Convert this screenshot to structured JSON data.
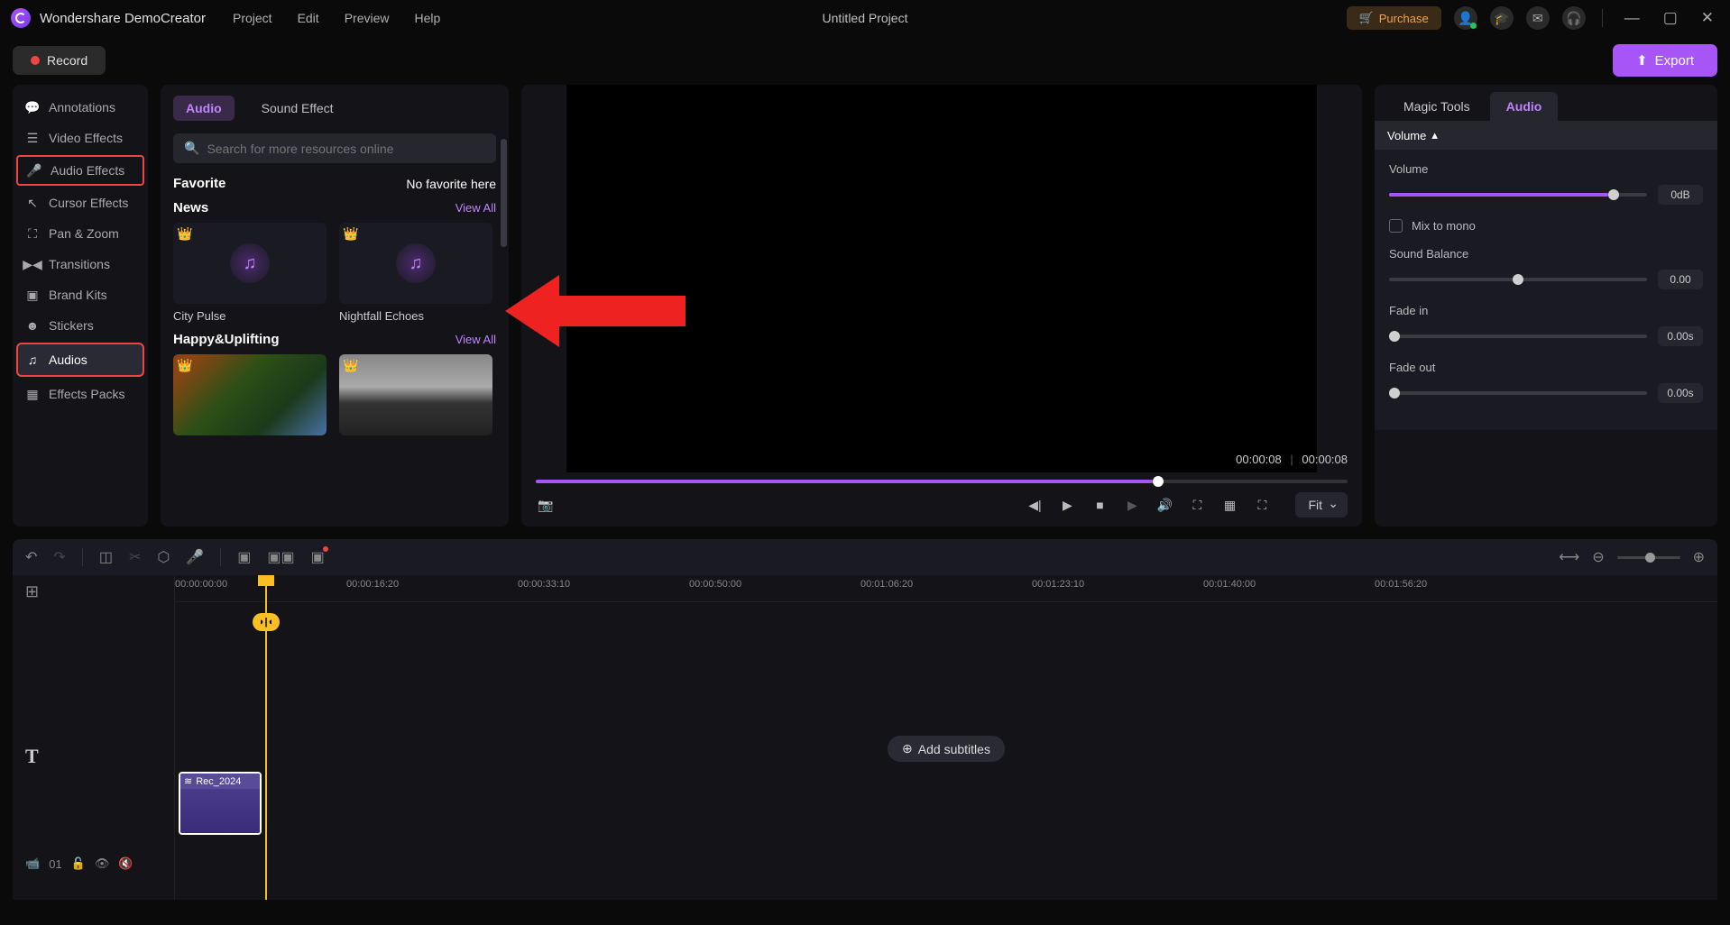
{
  "app_name": "Wondershare DemoCreator",
  "menu": [
    "Project",
    "Edit",
    "Preview",
    "Help"
  ],
  "project_title": "Untitled Project",
  "purchase": "Purchase",
  "record": "Record",
  "export": "Export",
  "sidebar": [
    {
      "label": "Annotations",
      "icon": "💬"
    },
    {
      "label": "Video Effects",
      "icon": "☰"
    },
    {
      "label": "Audio Effects",
      "icon": "🎤",
      "highlight": true
    },
    {
      "label": "Cursor Effects",
      "icon": "↖"
    },
    {
      "label": "Pan & Zoom",
      "icon": "⛶"
    },
    {
      "label": "Transitions",
      "icon": "▶◀"
    },
    {
      "label": "Brand Kits",
      "icon": "▣"
    },
    {
      "label": "Stickers",
      "icon": "☻"
    },
    {
      "label": "Audios",
      "icon": "♫",
      "active": true,
      "highlight": true
    },
    {
      "label": "Effects Packs",
      "icon": "▦"
    }
  ],
  "media": {
    "tabs": [
      "Audio",
      "Sound Effect"
    ],
    "active_tab": 0,
    "search_placeholder": "Search for more resources online",
    "favorite_title": "Favorite",
    "no_favorite": "No favorite here",
    "sections": [
      {
        "title": "News",
        "view_all": "View All",
        "cards": [
          {
            "label": "City Pulse"
          },
          {
            "label": "Nightfall Echoes"
          }
        ]
      },
      {
        "title": "Happy&Uplifting",
        "view_all": "View All"
      }
    ]
  },
  "preview": {
    "current_time": "00:00:08",
    "total_time": "00:00:08",
    "fit": "Fit"
  },
  "props": {
    "tabs": [
      "Magic Tools",
      "Audio"
    ],
    "active_tab": 1,
    "section": "Volume",
    "volume_label": "Volume",
    "volume_value": "0dB",
    "mix_mono": "Mix to mono",
    "balance_label": "Sound Balance",
    "balance_value": "0.00",
    "fadein_label": "Fade in",
    "fadein_value": "0.00s",
    "fadeout_label": "Fade out",
    "fadeout_value": "0.00s"
  },
  "timeline": {
    "marks": [
      "00:00:00:00",
      "00:00:16:20",
      "00:00:33:10",
      "00:00:50:00",
      "00:01:06:20",
      "00:01:23:10",
      "00:01:40:00",
      "00:01:56:20"
    ],
    "add_subtitles": "Add subtitles",
    "clip_name": "Rec_2024",
    "track_num": "01"
  }
}
